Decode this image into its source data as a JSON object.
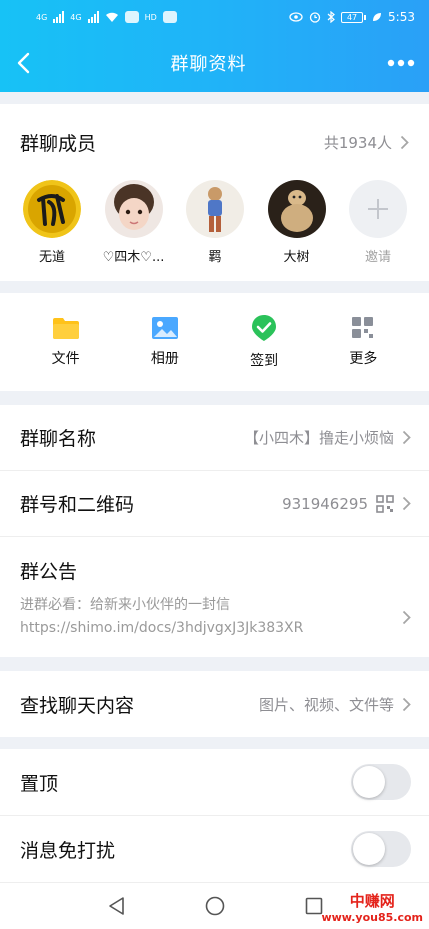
{
  "statusbar": {
    "net1": "4G",
    "net2": "4G",
    "hd": "HD",
    "battery": "47",
    "time": "5:53"
  },
  "nav": {
    "title": "群聊资料"
  },
  "members": {
    "title": "群聊成员",
    "count": "共1934人",
    "list": [
      {
        "name": "无道"
      },
      {
        "name": "♡四木♡..."
      },
      {
        "name": "羁"
      },
      {
        "name": "大树"
      }
    ],
    "invite": "邀请"
  },
  "tools": [
    {
      "label": "文件",
      "icon": "folder-icon"
    },
    {
      "label": "相册",
      "icon": "photo-album-icon"
    },
    {
      "label": "签到",
      "icon": "check-in-icon"
    },
    {
      "label": "更多",
      "icon": "grid-more-icon"
    }
  ],
  "info": {
    "name_label": "群聊名称",
    "name_value": "【小四木】撸走小烦恼",
    "id_label": "群号和二维码",
    "id_value": "931946295",
    "notice_label": "群公告",
    "notice_text": "进群必看：给新来小伙伴的一封信 https://shimo.im/docs/3hdjvgxJ3Jk383XR"
  },
  "search": {
    "label": "查找聊天内容",
    "value": "图片、视频、文件等"
  },
  "settings": {
    "pin_label": "置顶",
    "mute_label": "消息免打扰"
  },
  "watermark": {
    "top": "中赚网",
    "bottom": "www.you85.com"
  },
  "colors": {
    "header_start": "#17c2f6",
    "header_end": "#2aa0f7",
    "check_green": "#2bc25a",
    "folder_yellow": "#ffc21a",
    "album_blue": "#4aa8ff"
  }
}
